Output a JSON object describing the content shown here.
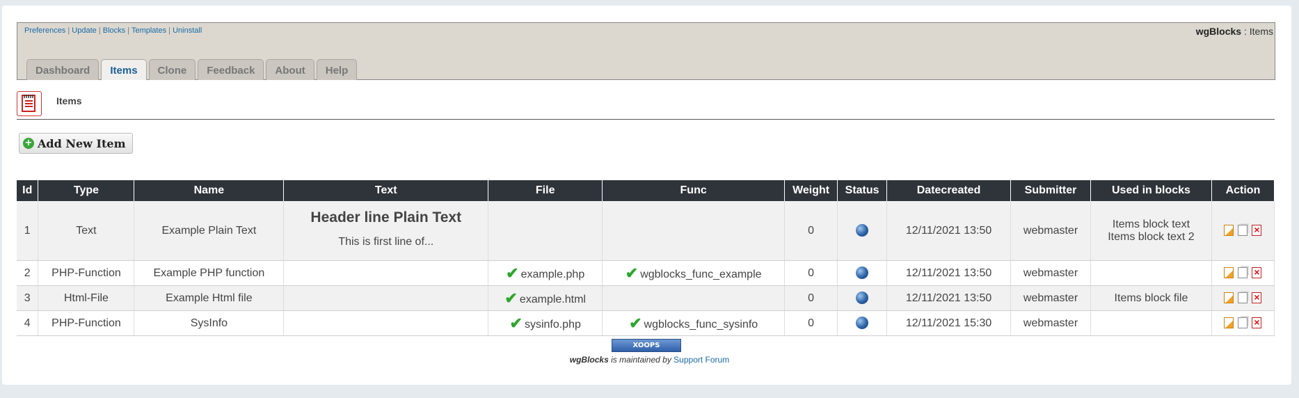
{
  "toplinks": [
    "Preferences",
    "Update",
    "Blocks",
    "Templates",
    "Uninstall"
  ],
  "module": {
    "name": "wgBlocks",
    "section": " : Items"
  },
  "tabs": [
    "Dashboard",
    "Items",
    "Clone",
    "Feedback",
    "About",
    "Help"
  ],
  "active_tab": "Items",
  "breadcrumb": {
    "label": "Items"
  },
  "add_button": {
    "label": "Add New Item"
  },
  "table": {
    "headers": [
      "Id",
      "Type",
      "Name",
      "Text",
      "File",
      "Func",
      "Weight",
      "Status",
      "Datecreated",
      "Submitter",
      "Used in blocks",
      "Action"
    ],
    "rows": [
      {
        "id": "1",
        "type": "Text",
        "name": "Example Plain Text",
        "text_header": "Header line Plain Text",
        "text_line": "This is first line of...",
        "file": "",
        "func": "",
        "weight": "0",
        "date": "12/11/2021 13:50",
        "submitter": "webmaster",
        "used": [
          "Items block text",
          "Items block text 2"
        ]
      },
      {
        "id": "2",
        "type": "PHP-Function",
        "name": "Example PHP function",
        "file": "example.php",
        "func": "wgblocks_func_example",
        "weight": "0",
        "date": "12/11/2021 13:50",
        "submitter": "webmaster",
        "used": []
      },
      {
        "id": "3",
        "type": "Html-File",
        "name": "Example Html file",
        "file": "example.html",
        "func": "",
        "weight": "0",
        "date": "12/11/2021 13:50",
        "submitter": "webmaster",
        "used": [
          "Items block file"
        ]
      },
      {
        "id": "4",
        "type": "PHP-Function",
        "name": "SysInfo",
        "file": "sysinfo.php",
        "func": "wgblocks_func_sysinfo",
        "weight": "0",
        "date": "12/11/2021 15:30",
        "submitter": "webmaster",
        "used": []
      }
    ]
  },
  "footer": {
    "badge": "XOOPS",
    "module": "wgBlocks",
    "text": " is maintained by ",
    "link": "Support Forum"
  },
  "colors": {
    "header_bg": "#dcd8d0",
    "table_head": "#2f343a",
    "link": "#1a6aa5",
    "check": "#2ea52e"
  }
}
